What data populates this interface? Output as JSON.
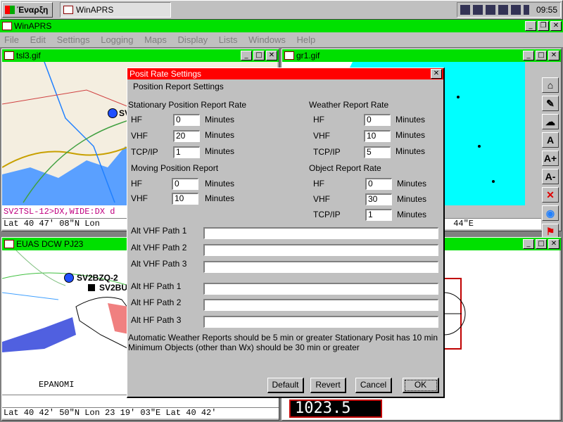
{
  "taskbar": {
    "start_label": "Έναρξη",
    "task_label": "WinAPRS",
    "clock": "09:55"
  },
  "app": {
    "title": "WinAPRS",
    "menu": [
      "File",
      "Edit",
      "Settings",
      "Logging",
      "Maps",
      "Display",
      "Lists",
      "Windows",
      "Help"
    ]
  },
  "win_tsl3": {
    "title": "tsl3.gif",
    "callsign": "SV2TSL",
    "packet_line": "SV2TSL-12>DX,WIDE:DX d",
    "status": "Lat  40 47' 08\"N  Lon"
  },
  "win_gr1": {
    "title": "gr1.gif",
    "status": "44\"E"
  },
  "win_euas": {
    "title": "EUAS DCW PJ23",
    "station1": "SV2BZQ-2",
    "station2": "SV2BU",
    "place": "EPANOMI",
    "status": "Lat  40 42' 50\"N  Lon  23 19' 03\"E  Lat  40 42'"
  },
  "dialog": {
    "title": "Posit Rate Settings",
    "heading": "Position Report Settings",
    "stationary_title": "Stationary Position Report Rate",
    "weather_title": "Weather Report Rate",
    "moving_title": "Moving Position Report",
    "object_title": "Object Report Rate",
    "labels": {
      "hf": "HF",
      "vhf": "VHF",
      "tcpip": "TCP/IP",
      "minutes": "Minutes"
    },
    "stationary": {
      "hf": "0",
      "vhf": "20",
      "tcpip": "1"
    },
    "weather": {
      "hf": "0",
      "vhf": "10",
      "tcpip": "5"
    },
    "moving": {
      "hf": "0",
      "vhf": "10"
    },
    "object": {
      "hf": "0",
      "vhf": "30",
      "tcpip": "1"
    },
    "paths": [
      {
        "label": "Alt VHF Path 1",
        "value": ""
      },
      {
        "label": "Alt VHF Path 2",
        "value": ""
      },
      {
        "label": "Alt VHF Path 3",
        "value": ""
      },
      {
        "label": "Alt HF Path 1",
        "value": ""
      },
      {
        "label": "Alt HF Path 2",
        "value": ""
      },
      {
        "label": "Alt HF Path 3",
        "value": ""
      }
    ],
    "note": "Automatic Weather Reports should be 5 min or greater  Stationary Posit has 10 min Minimum Objects (other than Wx) should be 30 min or greater",
    "buttons": {
      "default": "Default",
      "revert": "Revert",
      "cancel": "Cancel",
      "ok": "OK"
    }
  },
  "display_digits": "1023.5",
  "colors": {
    "title_green": "#00e000",
    "dialog_red": "#ff0000",
    "sea_cyan": "#00ffff"
  }
}
